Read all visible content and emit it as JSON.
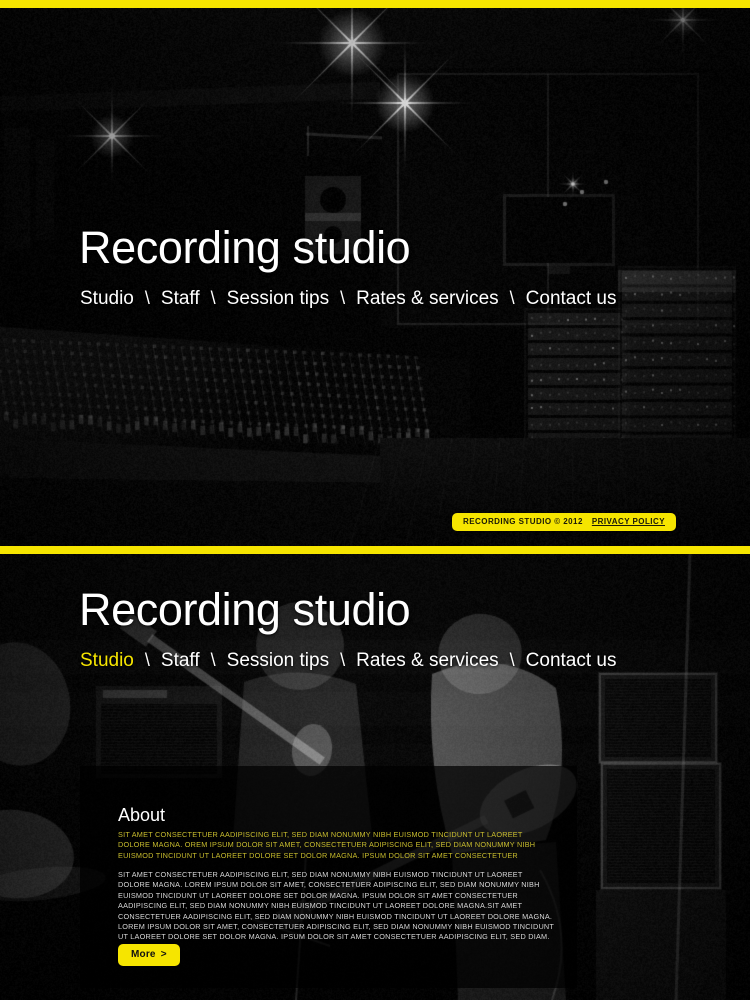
{
  "site": {
    "title": "Recording studio",
    "accent_color": "#f6e500",
    "background_color": "#000000"
  },
  "nav": {
    "separator": "\\",
    "items": [
      {
        "label": "Studio",
        "active_in_second_header": true
      },
      {
        "label": "Staff",
        "active_in_second_header": false
      },
      {
        "label": "Session tips",
        "active_in_second_header": false
      },
      {
        "label": "Rates & services",
        "active_in_second_header": false
      },
      {
        "label": "Contact us",
        "active_in_second_header": false
      }
    ]
  },
  "hero_top": {
    "title": "Recording studio",
    "image_alt": "dark recording studio control room with large mixing console, studio monitors and outboard equipment racks, star-burst light flares"
  },
  "hero_bottom": {
    "title": "Recording studio",
    "image_alt": "dark live-room photo of a band, guitarist with electric guitar, drum kit and amplifier cabinets"
  },
  "footer_badge": {
    "copyright": "RECORDING STUDIO  © 2012",
    "privacy_link": "PRIVACY POLICY"
  },
  "about": {
    "heading": "About",
    "paragraph_1": "SIT AMET CONSECTETUER AADIPISCING ELIT, SED DIAM NONUMMY NIBH EUISMOD TINCIDUNT UT LAOREET DOLORE MAGNA. OREM IPSUM DOLOR SIT AMET, CONSECTETUER ADIPISCING ELIT, SED DIAM NONUMMY NIBH EUISMOD TINCIDUNT UT LAOREET DOLORE SET DOLOR MAGNA.  IPSUM DOLOR SIT AMET CONSECTETUER",
    "paragraph_2": "SIT AMET CONSECTETUER AADIPISCING ELIT, SED DIAM NONUMMY NIBH EUISMOD TINCIDUNT UT LAOREET DOLORE MAGNA. LOREM IPSUM DOLOR SIT AMET, CONSECTETUER ADIPISCING ELIT, SED DIAM NONUMMY NIBH EUISMOD TINCIDUNT UT LAOREET DOLORE SET DOLOR MAGNA. IPSUM DOLOR SIT AMET CONSECTETUER AADIPISCING ELIT, SED DIAM NONUMMY NIBH EUISMOD TINCIDUNT UT LAOREET DOLORE MAGNA.SIT AMET CONSECTETUER AADIPISCING ELIT, SED DIAM NONUMMY NIBH EUISMOD TINCIDUNT UT LAOREET DOLORE MAGNA. LOREM IPSUM DOLOR SIT AMET, CONSECTETUER ADIPISCING ELIT, SED DIAM NONUMMY NIBH EUISMOD TINCIDUNT UT LAOREET DOLORE SET DOLOR MAGNA.  IPSUM DOLOR SIT AMET CONSECTETUER AADIPISCING ELIT, SED DIAM.",
    "more_label": "More",
    "more_chevron": ">"
  }
}
